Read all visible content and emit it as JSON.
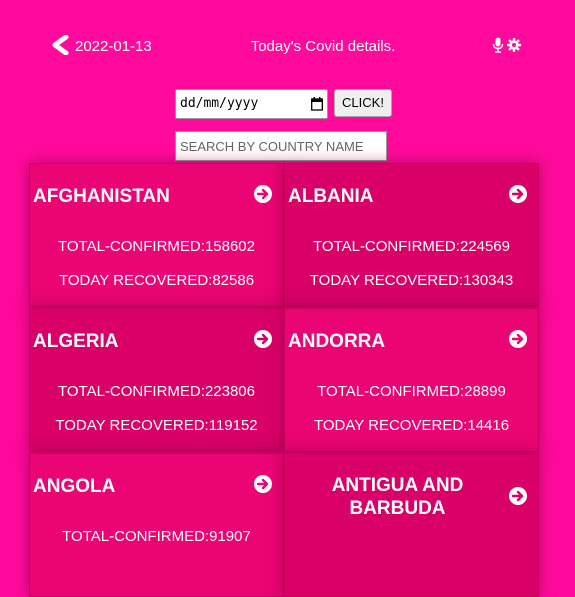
{
  "header": {
    "date": "2022-01-13",
    "title": "Today's Covid details."
  },
  "controls": {
    "date_placeholder": "dd/mm/yyyy",
    "click_label": "CLICK!",
    "search_placeholder": "SEARCH BY COUNTRY NAME"
  },
  "labels": {
    "confirmed_prefix": "TOTAL-CONFIRMED:",
    "recovered_prefix": "TODAY RECOVERED:"
  },
  "countries": [
    {
      "name": "AFGHANISTAN",
      "confirmed": "158602",
      "recovered": "82586"
    },
    {
      "name": "ALBANIA",
      "confirmed": "224569",
      "recovered": "130343"
    },
    {
      "name": "ALGERIA",
      "confirmed": "223806",
      "recovered": "119152"
    },
    {
      "name": "ANDORRA",
      "confirmed": "28899",
      "recovered": "14416"
    },
    {
      "name": "ANGOLA",
      "confirmed": "91907",
      "recovered": ""
    },
    {
      "name": "ANTIGUA AND BARBUDA",
      "confirmed": "",
      "recovered": ""
    }
  ],
  "colors": {
    "background": "#ff0a9c",
    "card": "#ea0474",
    "card_alt": "#d90068"
  }
}
